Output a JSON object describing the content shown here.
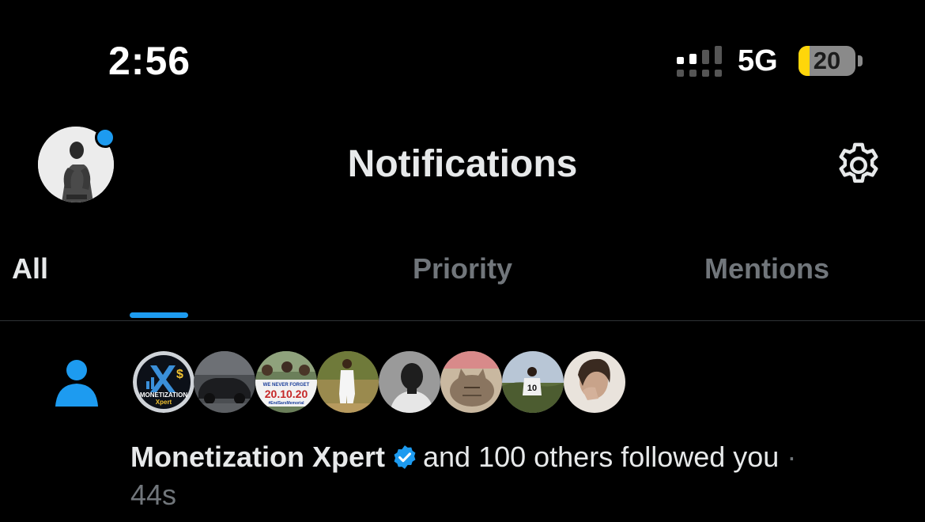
{
  "status_bar": {
    "time": "2:56",
    "network": "5G",
    "battery": "20",
    "battery_level": 0.2,
    "low_power_color": "#ffd60a"
  },
  "header": {
    "title": "Notifications",
    "avatar_icon": "profile-avatar",
    "settings_icon": "gear-icon",
    "unread_dot_color": "#1d9bf0"
  },
  "tabs": [
    {
      "label": "All",
      "active": true
    },
    {
      "label": "Priority",
      "active": false
    },
    {
      "label": "Mentions",
      "active": false
    }
  ],
  "notification": {
    "icon": "person-icon",
    "icon_color": "#1d9bf0",
    "avatars": [
      {
        "name": "monetization-xpert",
        "logo_text": "MONETIZATION",
        "logo_sub": "Xpert"
      },
      {
        "name": "car-photo"
      },
      {
        "name": "protest-photo",
        "line1": "WE NEVER FORGET",
        "line2": "20.10.20",
        "line3": "#EndSarsMemorial"
      },
      {
        "name": "man-in-white"
      },
      {
        "name": "bw-portrait"
      },
      {
        "name": "cat-photo"
      },
      {
        "name": "jersey-photo",
        "jersey_number": "10"
      },
      {
        "name": "woman-photo"
      }
    ],
    "user_name": "Monetization Xpert",
    "message": "and 100 others followed you",
    "separator": "·",
    "timestamp": "44s"
  },
  "colors": {
    "accent": "#1d9bf0",
    "background": "#000000",
    "text_primary": "#e7e9ea",
    "text_secondary": "#71767b",
    "divider": "#2f3336"
  }
}
